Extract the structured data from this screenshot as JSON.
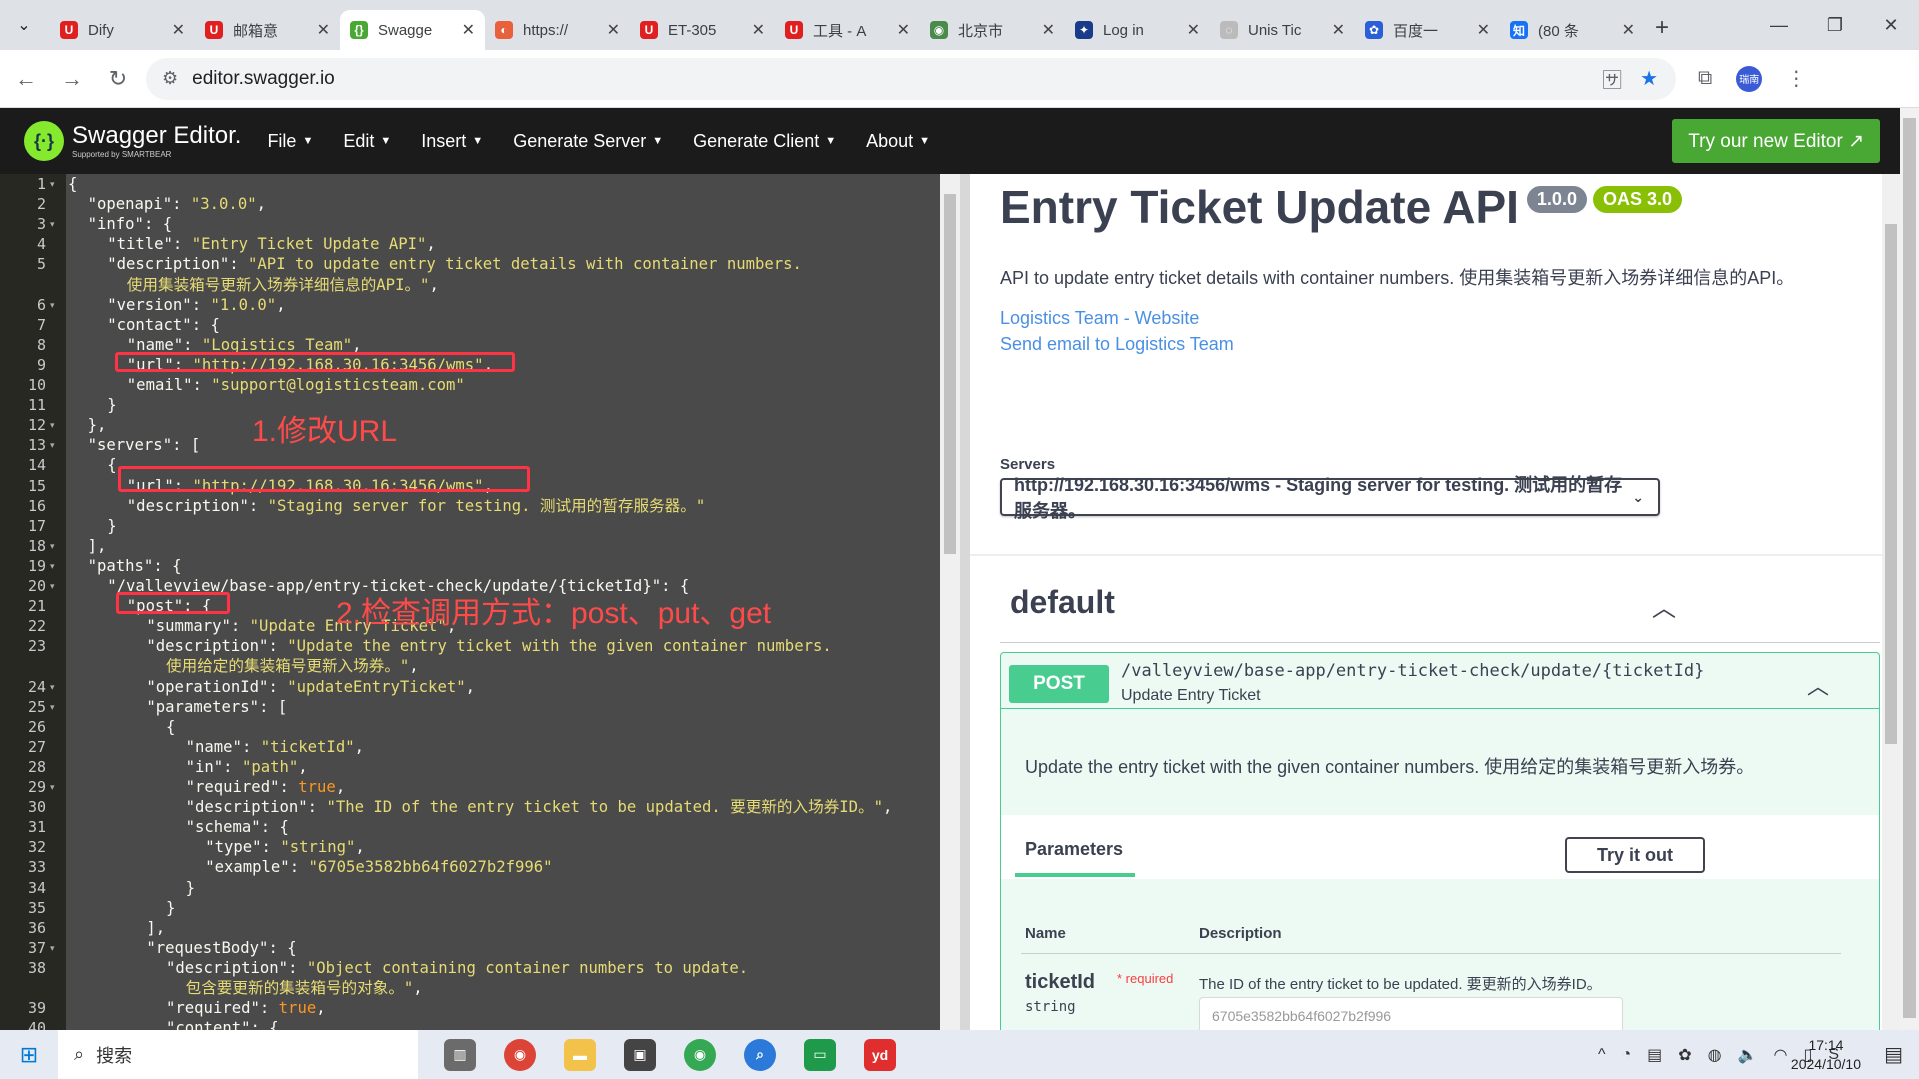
{
  "browser": {
    "tabs": [
      {
        "title": "Dify",
        "fav": "U",
        "color": "#e02020",
        "active": false
      },
      {
        "title": "邮箱意",
        "fav": "U",
        "color": "#e02020",
        "active": false
      },
      {
        "title": "Swagge",
        "fav": "{}",
        "color": "#49a834",
        "active": true
      },
      {
        "title": "https://",
        "fav": "◐",
        "color": "#e8603c",
        "active": false
      },
      {
        "title": "ET-305",
        "fav": "U",
        "color": "#e02020",
        "active": false
      },
      {
        "title": "工具 - A",
        "fav": "U",
        "color": "#e02020",
        "active": false
      },
      {
        "title": "北京市",
        "fav": "◉",
        "color": "#4a8a4a",
        "active": false
      },
      {
        "title": "Log in",
        "fav": "✦",
        "color": "#1a3a8a",
        "active": false
      },
      {
        "title": "Unis Tic",
        "fav": "◌",
        "color": "#bbbbbb",
        "active": false
      },
      {
        "title": "百度一",
        "fav": "✿",
        "color": "#2a5fd8",
        "active": false
      },
      {
        "title": "(80 条",
        "fav": "知",
        "color": "#1772f6",
        "active": false
      }
    ],
    "url": "editor.swagger.io",
    "avatar_text": "瑞南"
  },
  "topbar": {
    "logo_main": "Swagger Editor.",
    "logo_sub": "Supported by SMARTBEAR",
    "menu": [
      "File",
      "Edit",
      "Insert",
      "Generate Server",
      "Generate Client",
      "About"
    ],
    "try_button": "Try our new Editor ↗"
  },
  "editor": {
    "line_numbers": [
      "1",
      "2",
      "3",
      "4",
      "5",
      "",
      "6",
      "7",
      "8",
      "9",
      "10",
      "11",
      "12",
      "13",
      "14",
      "15",
      "16",
      "17",
      "18",
      "19",
      "20",
      "21",
      "22",
      "23",
      "",
      "24",
      "25",
      "26",
      "27",
      "28",
      "29",
      "30",
      "31",
      "32",
      "33",
      "34",
      "35",
      "36",
      "37",
      "38",
      "",
      "39",
      "40"
    ],
    "annotations": [
      {
        "text": "1.修改URL"
      },
      {
        "text": "2.检查调用方式：post、put、get"
      }
    ]
  },
  "doc": {
    "title": "Entry Ticket Update API",
    "version": "1.0.0",
    "oas": "OAS 3.0",
    "description": "API to update entry ticket details with container numbers. 使用集装箱号更新入场券详细信息的API。",
    "contact_website": "Logistics Team - Website",
    "contact_email": "Send email to Logistics Team",
    "servers_label": "Servers",
    "server_selected": "http://192.168.30.16:3456/wms - Staging server for testing. 测试用的暂存服务器。",
    "tag": "default",
    "op": {
      "method": "POST",
      "path": "/valleyview/base-app/entry-ticket-check/update/{ticketId}",
      "summary": "Update Entry Ticket",
      "description": "Update the entry ticket with the given container numbers. 使用给定的集装箱号更新入场券。"
    },
    "params_tab": "Parameters",
    "try_it_out": "Try it out",
    "col_name": "Name",
    "col_desc": "Description",
    "param": {
      "name": "ticketId",
      "required": "* required",
      "type": "string",
      "description": "The ID of the entry ticket to be updated. 要更新的入场券ID。",
      "placeholder": "6705e3582bb64f6027b2f996"
    }
  },
  "taskbar": {
    "search": "搜索",
    "time": "17:14",
    "date": "2024/10/10"
  }
}
